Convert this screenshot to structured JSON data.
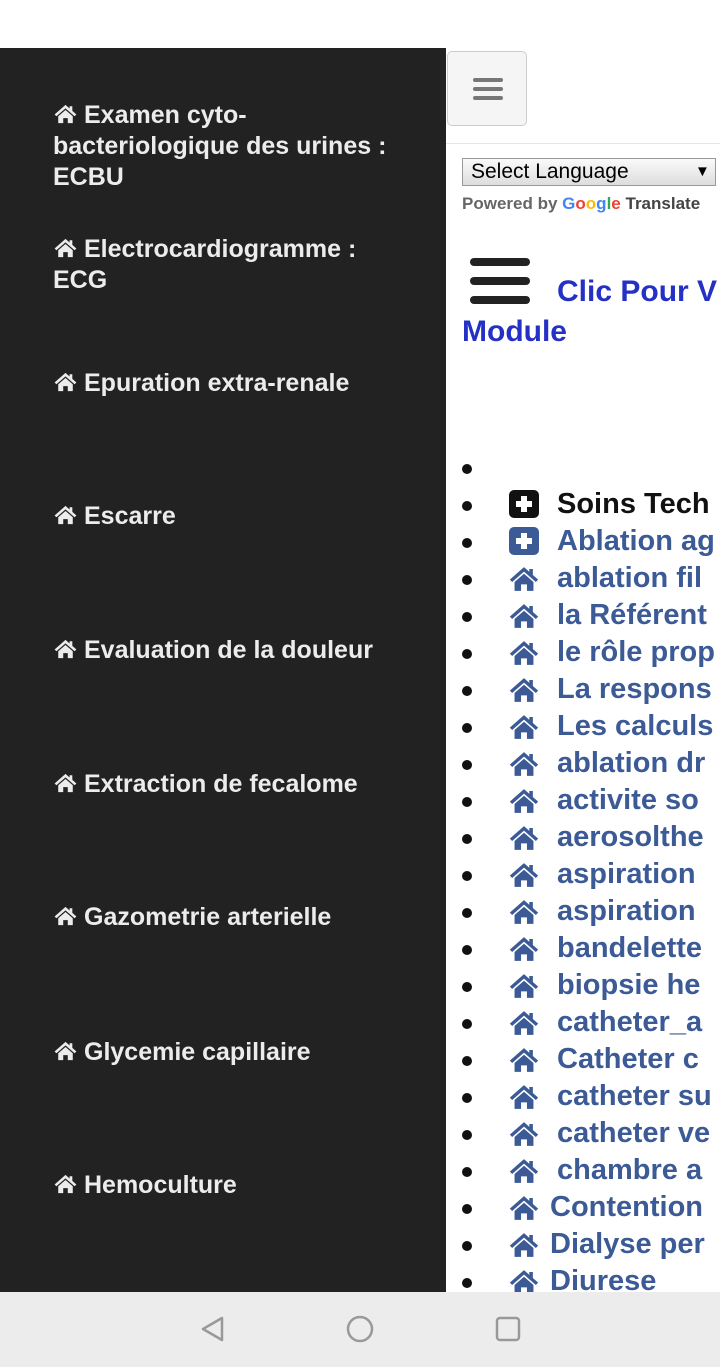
{
  "sidebar": {
    "items": [
      {
        "label": "Examen cyto-bacteriologique des urines : ECBU",
        "icon": "home-icon"
      },
      {
        "label": "Electrocardiogramme : ECG",
        "icon": "home-icon"
      },
      {
        "label": "Epuration extra-renale",
        "icon": "home-icon"
      },
      {
        "label": "Escarre",
        "icon": "home-icon"
      },
      {
        "label": "Evaluation de la douleur",
        "icon": "home-icon"
      },
      {
        "label": "Extraction de fecalome",
        "icon": "home-icon"
      },
      {
        "label": "Gazometrie arterielle",
        "icon": "home-icon"
      },
      {
        "label": "Glycemie capillaire",
        "icon": "home-icon"
      },
      {
        "label": "Hemoculture",
        "icon": "home-icon"
      }
    ]
  },
  "main": {
    "language_select": {
      "value": "Select Language"
    },
    "powered_by": "Powered by",
    "google": "Google",
    "translate": "Translate",
    "module_link": {
      "line1": "Clic Pour V",
      "line2": "Module"
    },
    "list": [
      {
        "label": "",
        "icon": "none"
      },
      {
        "label": "Soins Tech",
        "icon": "plus-square-icon",
        "dark": true
      },
      {
        "label": "Ablation ag",
        "icon": "plus-square-icon"
      },
      {
        "label": "ablation fil",
        "icon": "home-icon"
      },
      {
        "label": "la Référent",
        "icon": "home-icon"
      },
      {
        "label": "le rôle prop",
        "icon": "home-icon"
      },
      {
        "label": "La respons",
        "icon": "home-icon"
      },
      {
        "label": "Les calculs",
        "icon": "home-icon"
      },
      {
        "label": "ablation dr",
        "icon": "home-icon"
      },
      {
        "label": "activite so",
        "icon": "home-icon"
      },
      {
        "label": "aerosolthe",
        "icon": "home-icon"
      },
      {
        "label": "aspiration",
        "icon": "home-icon"
      },
      {
        "label": "aspiration",
        "icon": "home-icon"
      },
      {
        "label": "bandelette",
        "icon": "home-icon"
      },
      {
        "label": "biopsie he",
        "icon": "home-icon"
      },
      {
        "label": "catheter_a",
        "icon": "home-icon"
      },
      {
        "label": "Catheter c",
        "icon": "home-icon"
      },
      {
        "label": "catheter su",
        "icon": "home-icon"
      },
      {
        "label": "catheter ve",
        "icon": "home-icon"
      },
      {
        "label": "chambre a",
        "icon": "home-icon"
      },
      {
        "label": "Contention",
        "icon": "home-icon",
        "tight": true
      },
      {
        "label": "Dialyse per",
        "icon": "home-icon",
        "tight": true
      },
      {
        "label": "Diurese",
        "icon": "home-icon",
        "tight": true
      }
    ]
  },
  "colors": {
    "sidebar_bg": "#222222",
    "link": "#3b5a96",
    "module_link": "#2431c4"
  },
  "navbar": {
    "buttons": [
      "back-icon",
      "home-circle-icon",
      "recents-icon"
    ]
  }
}
